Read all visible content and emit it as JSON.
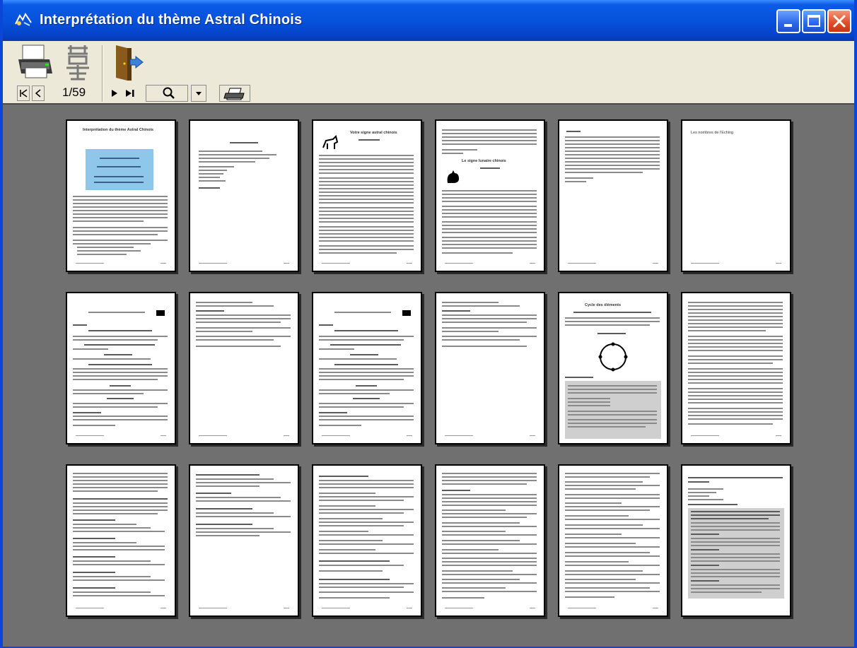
{
  "window": {
    "title": "Interprétation du thème Astral Chinois"
  },
  "toolbar": {
    "page_indicator": "1/59"
  },
  "thumbnails": {
    "page_title": "Interprétation du thème Astral Chinois",
    "section_heading": "Les nombres de l'Eching",
    "animal_heading_1": "Votre signe astral chinois",
    "animal_heading_2": "Le signe lunaire chinois",
    "cycle_heading": "Cycle des éléments"
  }
}
